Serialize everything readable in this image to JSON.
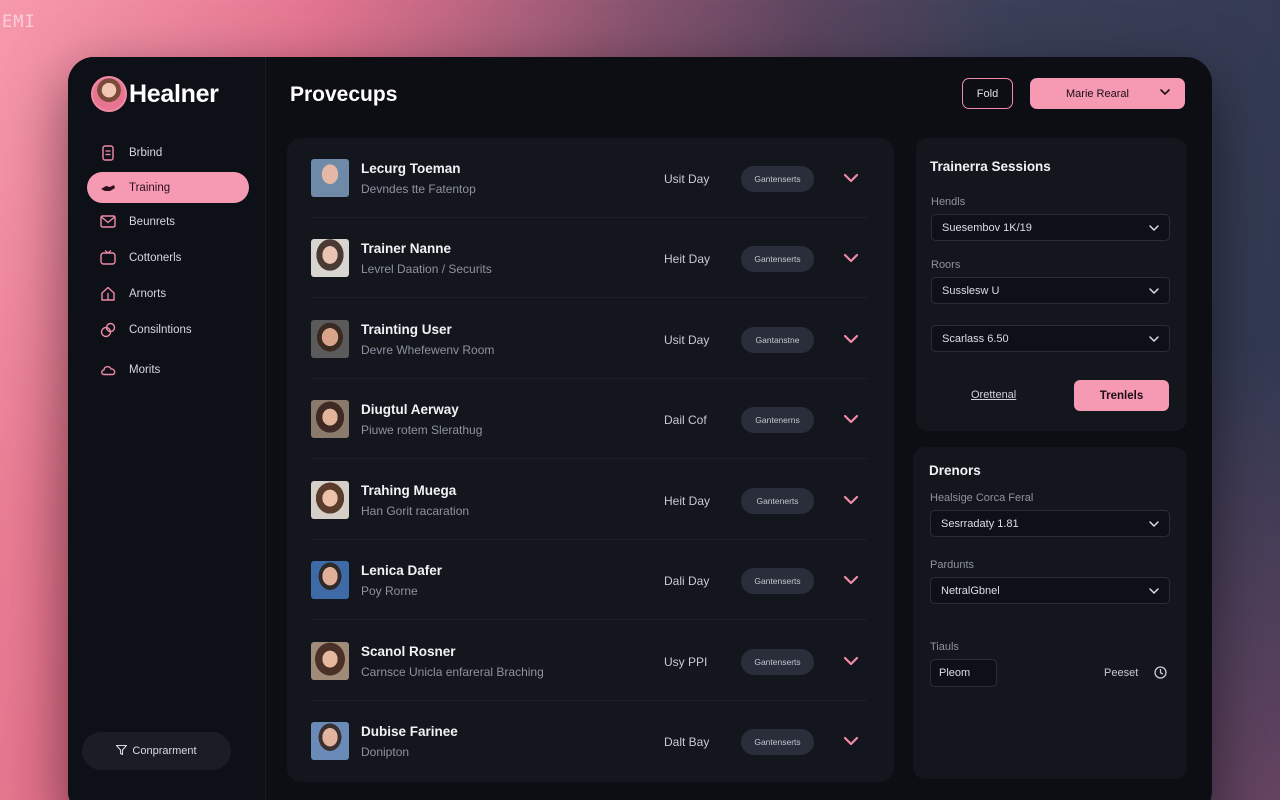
{
  "corner_text": "EMI",
  "brand": {
    "name": "Healner"
  },
  "nav": [
    {
      "label": "Brbind",
      "icon": "document-icon",
      "active": false
    },
    {
      "label": "Training",
      "icon": "hand-icon",
      "active": true
    },
    {
      "label": "Beunrets",
      "icon": "mail-icon",
      "active": false
    },
    {
      "label": "Cottonerls",
      "icon": "tv-icon",
      "active": false
    },
    {
      "label": "Arnorts",
      "icon": "home-icon",
      "active": false
    },
    {
      "label": "Consilntions",
      "icon": "link-icon",
      "active": false
    },
    {
      "label": "Morits",
      "icon": "cloud-icon",
      "active": false
    }
  ],
  "compartment_button": {
    "label": "Conprarment",
    "icon": "filter-icon"
  },
  "header": {
    "title": "Provecups",
    "fold_label": "Fold",
    "user_label": "Marie Rearal"
  },
  "list": [
    {
      "name": "Lecurg Toeman",
      "sub": "Devndes tte Fatentop",
      "day": "Usit Day",
      "badge": "Gantenserts"
    },
    {
      "name": "Trainer Nanne",
      "sub": "Levrel Daation / Securits",
      "day": "Heit Day",
      "badge": "Gantenserts"
    },
    {
      "name": "Trainting User",
      "sub": "Devre Whefewenv Room",
      "day": "Usit Day",
      "badge": "Gantanstne"
    },
    {
      "name": "Diugtul Aerway",
      "sub": "Piuwe rotem Slerathug",
      "day": "Dail Cof",
      "badge": "Gantenerns"
    },
    {
      "name": "Trahing Muega",
      "sub": "Han Gorit racaration",
      "day": "Heit Day",
      "badge": "Gantenerts"
    },
    {
      "name": "Lenica Dafer",
      "sub": "Poy Rorne",
      "day": "Dali Day",
      "badge": "Gantenserts"
    },
    {
      "name": "Scanol Rosner",
      "sub": "Carnsce Unicla enfareral Braching",
      "day": "Usy PPI",
      "badge": "Gantenserts"
    },
    {
      "name": "Dubise Farinee",
      "sub": "Donipton",
      "day": "Dalt Bay",
      "badge": "Gantenserts"
    }
  ],
  "sessions": {
    "title": "Trainerra Sessions",
    "field1_label": "Hendls",
    "field1_value": "Suesembov 1K/19",
    "field2_label": "Roors",
    "field2_value": "Susslesw U",
    "field3_value": "Scarlass 6.50",
    "link_label": "Orettenal",
    "primary_label": "Trenlels"
  },
  "drenors": {
    "title": "Drenors",
    "field1_label": "Healsige Corca Feral",
    "field1_value": "Sesrradaty 1.81",
    "field2_label": "Pardunts",
    "field2_value": "NetralGbnel",
    "field3_label": "Tiauls",
    "field3_value": "Pleom",
    "reset_label": "Peeset"
  },
  "colors": {
    "accent": "#f59ab2",
    "panel": "#14161e",
    "window": "#0c0e14"
  }
}
